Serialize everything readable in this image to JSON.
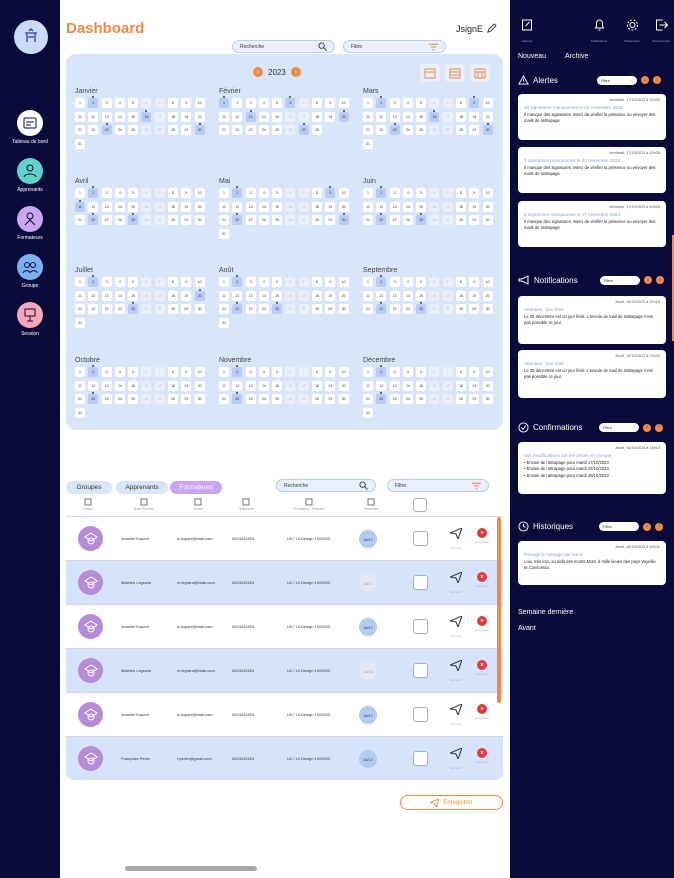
{
  "left_nav": {
    "items": [
      {
        "label": "Tableau de bord",
        "icon": "dashboard-icon",
        "color": "#ffffff"
      },
      {
        "label": "Apprenants",
        "icon": "learners-icon",
        "color": "#5fd3c7"
      },
      {
        "label": "Formateurs",
        "icon": "trainers-icon",
        "color": "#c9a6f0"
      },
      {
        "label": "Groupe",
        "icon": "group-icon",
        "color": "#7fb0f2"
      },
      {
        "label": "Session",
        "icon": "session-icon",
        "color": "#f7a8b8"
      }
    ]
  },
  "header": {
    "title": "Dashboard",
    "brand": "JsignE",
    "search_placeholder": "Recherche",
    "filter_label": "Filtre"
  },
  "calendar": {
    "year": "2023",
    "months": [
      {
        "name": "Janvier",
        "days": 31,
        "offset": 1,
        "marked": [
          2,
          16,
          23,
          30
        ]
      },
      {
        "name": "Février",
        "days": 28,
        "offset": 1,
        "marked": [
          1,
          6,
          13,
          20,
          27
        ]
      },
      {
        "name": "Mars",
        "days": 31,
        "offset": 1,
        "marked": [
          2,
          9,
          16,
          23,
          30
        ]
      },
      {
        "name": "Avril",
        "days": 30,
        "offset": 1,
        "marked": [
          2,
          11,
          22,
          25
        ]
      },
      {
        "name": "Mai",
        "days": 31,
        "offset": 1,
        "marked": [
          2,
          9,
          22,
          30
        ]
      },
      {
        "name": "Juin",
        "days": 30,
        "offset": 1,
        "marked": [
          2,
          22,
          25
        ]
      },
      {
        "name": "Juillet",
        "days": 31,
        "offset": 1,
        "marked": [
          2,
          20,
          25
        ]
      },
      {
        "name": "Août",
        "days": 31,
        "offset": 1,
        "marked": [
          2,
          22,
          25
        ]
      },
      {
        "name": "Septembre",
        "days": 30,
        "offset": 1,
        "marked": [
          2,
          22,
          25
        ]
      },
      {
        "name": "Octobre",
        "days": 31,
        "offset": 1,
        "marked": [
          2,
          22
        ]
      },
      {
        "name": "Novembre",
        "days": 30,
        "offset": 1,
        "marked": [
          2,
          22
        ]
      },
      {
        "name": "Décembre",
        "days": 31,
        "offset": 1,
        "marked": [
          2,
          22
        ]
      }
    ]
  },
  "tabs": [
    "Groupes",
    "Apprenants",
    "Formateurs"
  ],
  "table": {
    "search_placeholder": "Recherche",
    "filter_label": "Filtre",
    "columns": [
      "Photo",
      "Nom Prénom",
      "Email",
      "Téléphone",
      "Formation / Session",
      "Présence"
    ],
    "send_label": "Envoyer",
    "delete_label": "Supprimer",
    "rows": [
      {
        "name": "Annette Dupont",
        "email": "a.dupont@mail.com",
        "phone": "0623242524",
        "session": "UX / UI Design 19/09/23",
        "status": "14/17",
        "status_active": true
      },
      {
        "name": "Mathieu Legrand",
        "email": "m.legrand@mail.com",
        "phone": "0623242524",
        "session": "UX / UI Design 19/09/23",
        "status": "10/17",
        "status_active": false
      },
      {
        "name": "Annette Dupont",
        "email": "a.dupont@mail.com",
        "phone": "0623242524",
        "session": "UX / UI Design 19/09/23",
        "status": "14/17",
        "status_active": true
      },
      {
        "name": "Mathieu Legrand",
        "email": "m.legrand@mail.com",
        "phone": "0623242524",
        "session": "UX / UI Design 19/09/23",
        "status": "11/16",
        "status_active": false
      },
      {
        "name": "Annette Dupont",
        "email": "a.dupont@mail.com",
        "phone": "0623242524",
        "session": "UX / UI Design 19/09/23",
        "status": "14/17",
        "status_active": true
      },
      {
        "name": "Françoise Perrin",
        "email": "f.perrin@gmail.com",
        "phone": "0623242524",
        "session": "UX / UI Design 19/09/23",
        "status": "14/17",
        "status_active": true
      }
    ],
    "save_label": "Enregistrer"
  },
  "right_panel": {
    "top_icons": [
      {
        "icon": "edit-icon",
        "label": "Générer"
      },
      {
        "icon": "bell-icon",
        "label": "Notifications"
      },
      {
        "icon": "gear-icon",
        "label": "Paramètres"
      },
      {
        "icon": "logout-icon",
        "label": "Déconnexion"
      }
    ],
    "tabs": [
      "Nouveau",
      "Archive"
    ],
    "filter_label": "Filtre",
    "alertes": {
      "title": "Alertes",
      "cards": [
        {
          "date": "Vendredi, 17/10/2023",
          "time": "à 10h26",
          "link": "24 signatures manquantes le 04 novembre 2023",
          "text": "Il manque des signatures. Merci de vérifier la présence ou envoyer des mails de rattrapage"
        },
        {
          "date": "Vendredi, 17/10/2023",
          "time": "à 10h26",
          "link": "3 signatures manquantes le 30 novembre 2023",
          "text": "Il manque des signatures. Merci de vérifier la présence ou envoyer des mails de rattrapage"
        },
        {
          "date": "Vendredi, 17/10/2023",
          "time": "à 10h26",
          "link": "4 signatures manquantes le 17 novembre 2023",
          "text": "Il manque des signatures. Merci de vérifier la présence ou envoyer des mails de rattrapage"
        }
      ]
    },
    "notifications": {
      "title": "Notifications",
      "cards": [
        {
          "date": "Jeudi, 16/10/2023",
          "time": "à 20h15",
          "link": "Attention : jour férié",
          "text": "Le 25 décembre est un jour férié. L'envoie de mail de rattrapage n'est pas possible ce jour."
        },
        {
          "date": "Jeudi, 16/10/2023",
          "time": "à 13h43",
          "link": "Attention : jour férié",
          "text": "Le 25 décembre est un jour férié. L'envoie de mail de rattrapage n'est pas possible ce jour."
        }
      ]
    },
    "confirmations": {
      "title": "Confirmations",
      "card": {
        "date": "Jeudi, 16/10/2023",
        "time": "à 14h13",
        "link": "Vos modifications ont été prises en compte",
        "items": [
          "Envoie de rattrapage pour mardi 17/10/2023",
          "Envoie de rattrapage pour mardi 24/10/2023",
          "Envoie de rattrapage pour mardi 25/10/2023"
        ]
      }
    },
    "historiques": {
      "title": "Historiques",
      "card": {
        "date": "Jeudi, 16/10/2023",
        "time": "à 10h32",
        "link": "Partage le ménage par lae le",
        "text": "Loin, très loin, au delà des monts Mots, à mille lieues des pays Voyellie et Consonnia."
      }
    },
    "history_links": [
      "Semaine dernière",
      "Avant"
    ]
  },
  "colors": {
    "accent": "#f08a45",
    "navy": "#0b0b3b",
    "panel": "#d9e6fa",
    "marked": "#b7cdf5",
    "danger": "#e03a3a"
  }
}
